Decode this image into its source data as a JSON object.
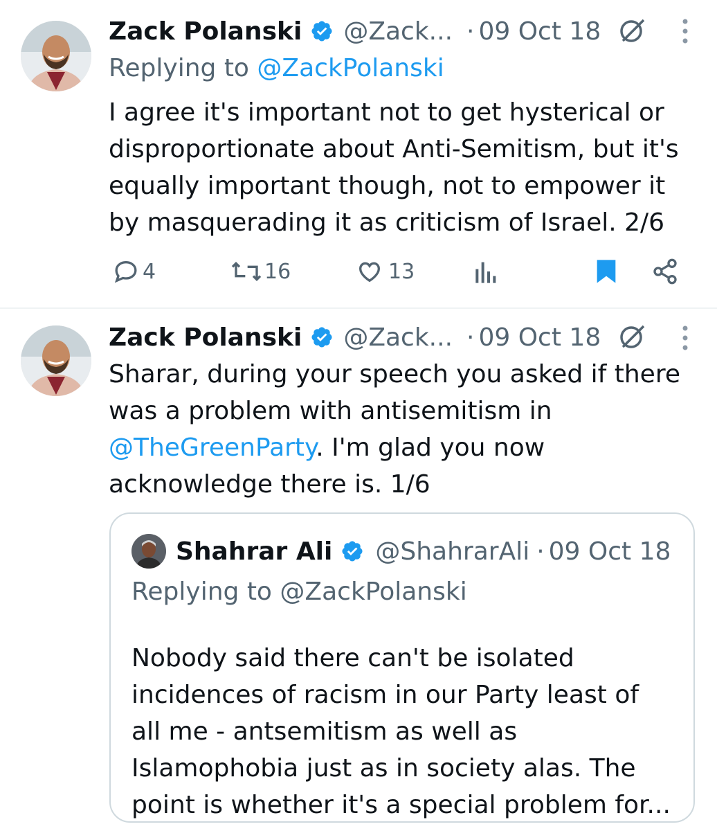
{
  "tweet1": {
    "author_name": "Zack Polanski",
    "handle": "@Zack...",
    "separator": "·",
    "date": "09 Oct 18",
    "reply_prefix": "Replying to",
    "reply_handle": "@ZackPolanski",
    "lines": [
      "I agree it's important not to get hysterical or",
      "disproportionate about Anti-Semitism, but it's",
      "equally important though, not to empower it",
      "by masquerading it as criticism of Israel. 2/6"
    ],
    "actions": {
      "replies": "4",
      "retweets": "16",
      "likes": "13"
    },
    "bookmark_color": "#1d9bf0"
  },
  "tweet2": {
    "author_name": "Zack Polanski",
    "handle": "@Zack...",
    "separator": "·",
    "date": "09 Oct 18",
    "line1": "Sharar, during your speech you asked if there",
    "line2": "was a problem with antisemitism in",
    "line3_mention": "@TheGreenParty",
    "line3_rest": ". I'm glad you now",
    "line4": "acknowledge there is. 1/6"
  },
  "quote": {
    "author_name": "Shahrar Ali",
    "handle": "@ShahrarAli",
    "separator": "·",
    "date": "09 Oct 18",
    "reply_prefix": "Replying to",
    "reply_handle": "@ZackPolanski",
    "lines": [
      "Nobody said there can't be isolated",
      "incidences of racism in our Party least of",
      "all me - antsemitism as well as",
      "Islamophobia just as in society alas. The",
      "point is whether it's a special problem for..."
    ]
  },
  "icons": {
    "verified": "verified-badge-icon",
    "grok": "grok-icon",
    "more": "more-vertical-icon",
    "reply": "reply-icon",
    "retweet": "retweet-icon",
    "like": "heart-icon",
    "views": "views-icon",
    "bookmark": "bookmark-icon",
    "share": "share-icon"
  },
  "colors": {
    "link": "#1d9bf0",
    "secondary_text": "#536471",
    "verified": "#1d9bf0"
  }
}
